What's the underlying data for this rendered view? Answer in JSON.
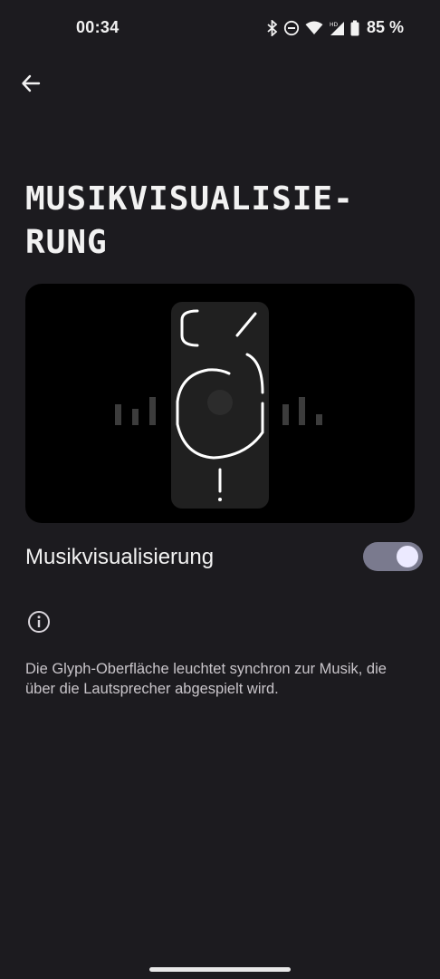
{
  "status_bar": {
    "time": "00:34",
    "battery": "85 %",
    "icons": [
      "bluetooth-icon",
      "do-not-disturb-icon",
      "wifi-icon",
      "signal-hd-icon",
      "battery-icon"
    ]
  },
  "header": {
    "back_icon": "arrow-left-icon",
    "title": "MUSIKVISUALISIE-\nRUNG"
  },
  "preview": {
    "image": "phone-glyph-illustration"
  },
  "setting": {
    "label": "Musikvisualisierung",
    "enabled": true
  },
  "info": {
    "icon": "info-icon",
    "description": "Die Glyph-Oberfläche leuchtet synchron zur Musik, die über die Lautsprecher abgespielt wird."
  },
  "colors": {
    "background": "#1c1b1f",
    "switch_track": "#7a7a8e",
    "switch_thumb": "#eceaff"
  }
}
